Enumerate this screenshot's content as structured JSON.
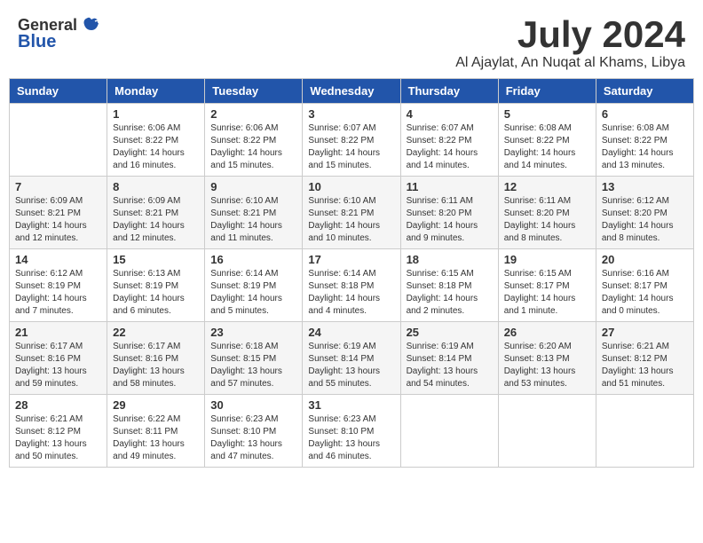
{
  "header": {
    "logo_general": "General",
    "logo_blue": "Blue",
    "month_year": "July 2024",
    "location": "Al Ajaylat, An Nuqat al Khams, Libya"
  },
  "days_of_week": [
    "Sunday",
    "Monday",
    "Tuesday",
    "Wednesday",
    "Thursday",
    "Friday",
    "Saturday"
  ],
  "weeks": [
    [
      {
        "num": "",
        "info": ""
      },
      {
        "num": "1",
        "info": "Sunrise: 6:06 AM\nSunset: 8:22 PM\nDaylight: 14 hours\nand 16 minutes."
      },
      {
        "num": "2",
        "info": "Sunrise: 6:06 AM\nSunset: 8:22 PM\nDaylight: 14 hours\nand 15 minutes."
      },
      {
        "num": "3",
        "info": "Sunrise: 6:07 AM\nSunset: 8:22 PM\nDaylight: 14 hours\nand 15 minutes."
      },
      {
        "num": "4",
        "info": "Sunrise: 6:07 AM\nSunset: 8:22 PM\nDaylight: 14 hours\nand 14 minutes."
      },
      {
        "num": "5",
        "info": "Sunrise: 6:08 AM\nSunset: 8:22 PM\nDaylight: 14 hours\nand 14 minutes."
      },
      {
        "num": "6",
        "info": "Sunrise: 6:08 AM\nSunset: 8:22 PM\nDaylight: 14 hours\nand 13 minutes."
      }
    ],
    [
      {
        "num": "7",
        "info": "Sunrise: 6:09 AM\nSunset: 8:21 PM\nDaylight: 14 hours\nand 12 minutes."
      },
      {
        "num": "8",
        "info": "Sunrise: 6:09 AM\nSunset: 8:21 PM\nDaylight: 14 hours\nand 12 minutes."
      },
      {
        "num": "9",
        "info": "Sunrise: 6:10 AM\nSunset: 8:21 PM\nDaylight: 14 hours\nand 11 minutes."
      },
      {
        "num": "10",
        "info": "Sunrise: 6:10 AM\nSunset: 8:21 PM\nDaylight: 14 hours\nand 10 minutes."
      },
      {
        "num": "11",
        "info": "Sunrise: 6:11 AM\nSunset: 8:20 PM\nDaylight: 14 hours\nand 9 minutes."
      },
      {
        "num": "12",
        "info": "Sunrise: 6:11 AM\nSunset: 8:20 PM\nDaylight: 14 hours\nand 8 minutes."
      },
      {
        "num": "13",
        "info": "Sunrise: 6:12 AM\nSunset: 8:20 PM\nDaylight: 14 hours\nand 8 minutes."
      }
    ],
    [
      {
        "num": "14",
        "info": "Sunrise: 6:12 AM\nSunset: 8:19 PM\nDaylight: 14 hours\nand 7 minutes."
      },
      {
        "num": "15",
        "info": "Sunrise: 6:13 AM\nSunset: 8:19 PM\nDaylight: 14 hours\nand 6 minutes."
      },
      {
        "num": "16",
        "info": "Sunrise: 6:14 AM\nSunset: 8:19 PM\nDaylight: 14 hours\nand 5 minutes."
      },
      {
        "num": "17",
        "info": "Sunrise: 6:14 AM\nSunset: 8:18 PM\nDaylight: 14 hours\nand 4 minutes."
      },
      {
        "num": "18",
        "info": "Sunrise: 6:15 AM\nSunset: 8:18 PM\nDaylight: 14 hours\nand 2 minutes."
      },
      {
        "num": "19",
        "info": "Sunrise: 6:15 AM\nSunset: 8:17 PM\nDaylight: 14 hours\nand 1 minute."
      },
      {
        "num": "20",
        "info": "Sunrise: 6:16 AM\nSunset: 8:17 PM\nDaylight: 14 hours\nand 0 minutes."
      }
    ],
    [
      {
        "num": "21",
        "info": "Sunrise: 6:17 AM\nSunset: 8:16 PM\nDaylight: 13 hours\nand 59 minutes."
      },
      {
        "num": "22",
        "info": "Sunrise: 6:17 AM\nSunset: 8:16 PM\nDaylight: 13 hours\nand 58 minutes."
      },
      {
        "num": "23",
        "info": "Sunrise: 6:18 AM\nSunset: 8:15 PM\nDaylight: 13 hours\nand 57 minutes."
      },
      {
        "num": "24",
        "info": "Sunrise: 6:19 AM\nSunset: 8:14 PM\nDaylight: 13 hours\nand 55 minutes."
      },
      {
        "num": "25",
        "info": "Sunrise: 6:19 AM\nSunset: 8:14 PM\nDaylight: 13 hours\nand 54 minutes."
      },
      {
        "num": "26",
        "info": "Sunrise: 6:20 AM\nSunset: 8:13 PM\nDaylight: 13 hours\nand 53 minutes."
      },
      {
        "num": "27",
        "info": "Sunrise: 6:21 AM\nSunset: 8:12 PM\nDaylight: 13 hours\nand 51 minutes."
      }
    ],
    [
      {
        "num": "28",
        "info": "Sunrise: 6:21 AM\nSunset: 8:12 PM\nDaylight: 13 hours\nand 50 minutes."
      },
      {
        "num": "29",
        "info": "Sunrise: 6:22 AM\nSunset: 8:11 PM\nDaylight: 13 hours\nand 49 minutes."
      },
      {
        "num": "30",
        "info": "Sunrise: 6:23 AM\nSunset: 8:10 PM\nDaylight: 13 hours\nand 47 minutes."
      },
      {
        "num": "31",
        "info": "Sunrise: 6:23 AM\nSunset: 8:10 PM\nDaylight: 13 hours\nand 46 minutes."
      },
      {
        "num": "",
        "info": ""
      },
      {
        "num": "",
        "info": ""
      },
      {
        "num": "",
        "info": ""
      }
    ]
  ]
}
